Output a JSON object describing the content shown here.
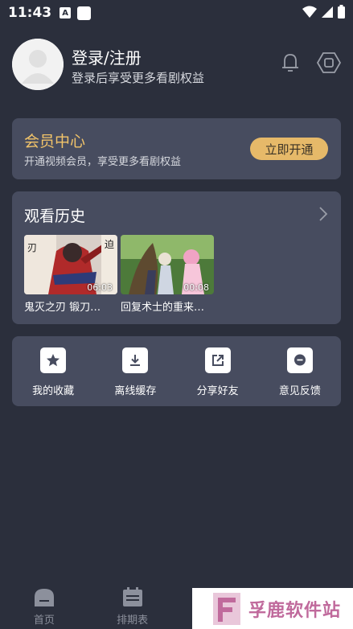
{
  "status_bar": {
    "time": "11:43",
    "app_badge": "A"
  },
  "profile": {
    "title": "登录/注册",
    "subtitle": "登录后享受更多看剧权益"
  },
  "vip": {
    "title": "会员中心",
    "subtitle": "开通视频会员，享受更多看剧权益",
    "button": "立即开通",
    "accent_color": "#e6b969"
  },
  "history": {
    "title": "观看历史",
    "items": [
      {
        "title": "鬼灭之刃 锻刀…",
        "time": "06:03"
      },
      {
        "title": "回复术士的重来…",
        "time": "00:08"
      }
    ]
  },
  "tools": [
    {
      "label": "我的收藏",
      "icon": "star-icon"
    },
    {
      "label": "离线缓存",
      "icon": "download-icon"
    },
    {
      "label": "分享好友",
      "icon": "share-icon"
    },
    {
      "label": "意见反馈",
      "icon": "feedback-icon"
    }
  ],
  "tabbar": [
    {
      "label": "首页",
      "icon": "home-icon"
    },
    {
      "label": "排期表",
      "icon": "calendar-icon"
    },
    {
      "label": "",
      "icon": "tab3-icon"
    },
    {
      "label": "",
      "icon": "tab4-icon"
    }
  ],
  "watermark": {
    "text": "孚鹿软件站"
  }
}
